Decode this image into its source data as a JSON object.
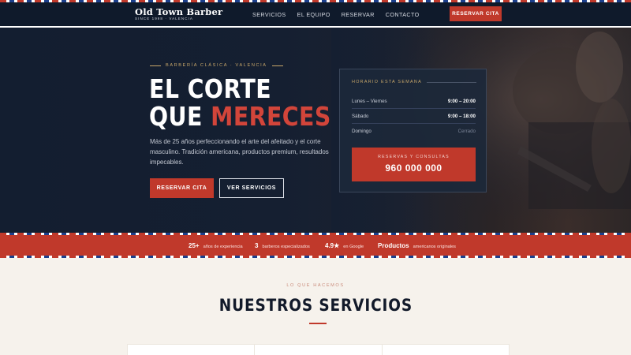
{
  "header": {
    "logo_title": "Old Town Barber",
    "logo_sub": "SINCE 1998 · VALENCIA",
    "nav": [
      "SERVICIOS",
      "EL EQUIPO",
      "RESERVAR",
      "CONTACTO"
    ],
    "cta": "RESERVAR CITA"
  },
  "hero": {
    "eyebrow": "BARBERÍA CLÁSICA · VALENCIA",
    "title_line1": "EL CORTE",
    "title_line2_a": "QUE",
    "title_line2_b": "MERECES",
    "description": "Más de 25 años perfeccionando el arte del afeitado y el corte masculino. Tradición americana, productos premium, resultados impecables.",
    "btn_primary": "RESERVAR CITA",
    "btn_secondary": "VER SERVICIOS"
  },
  "hours": {
    "heading": "HORARIO ESTA SEMANA",
    "rows": [
      {
        "day": "Lunes – Viernes",
        "time": "9:00 – 20:00"
      },
      {
        "day": "Sábado",
        "time": "9:00 – 18:00"
      },
      {
        "day": "Domingo",
        "time": "Cerrado"
      }
    ],
    "booking_label": "RESERVAS Y CONSULTAS",
    "phone": "960 000 000"
  },
  "stats": [
    {
      "num": "25+",
      "label": "años de experiencia"
    },
    {
      "num": "3",
      "label": "barberos especializados"
    },
    {
      "num": "4.9★",
      "label": "en Google"
    },
    {
      "num": "Productos",
      "label": "americanos originales"
    }
  ],
  "services": {
    "eyebrow": "LO QUE HACEMOS",
    "title": "NUESTROS SERVICIOS"
  },
  "colors": {
    "accent": "#c0392b",
    "navy": "#131e30",
    "gold": "#c9a86a",
    "cream": "#f6f2ec"
  }
}
